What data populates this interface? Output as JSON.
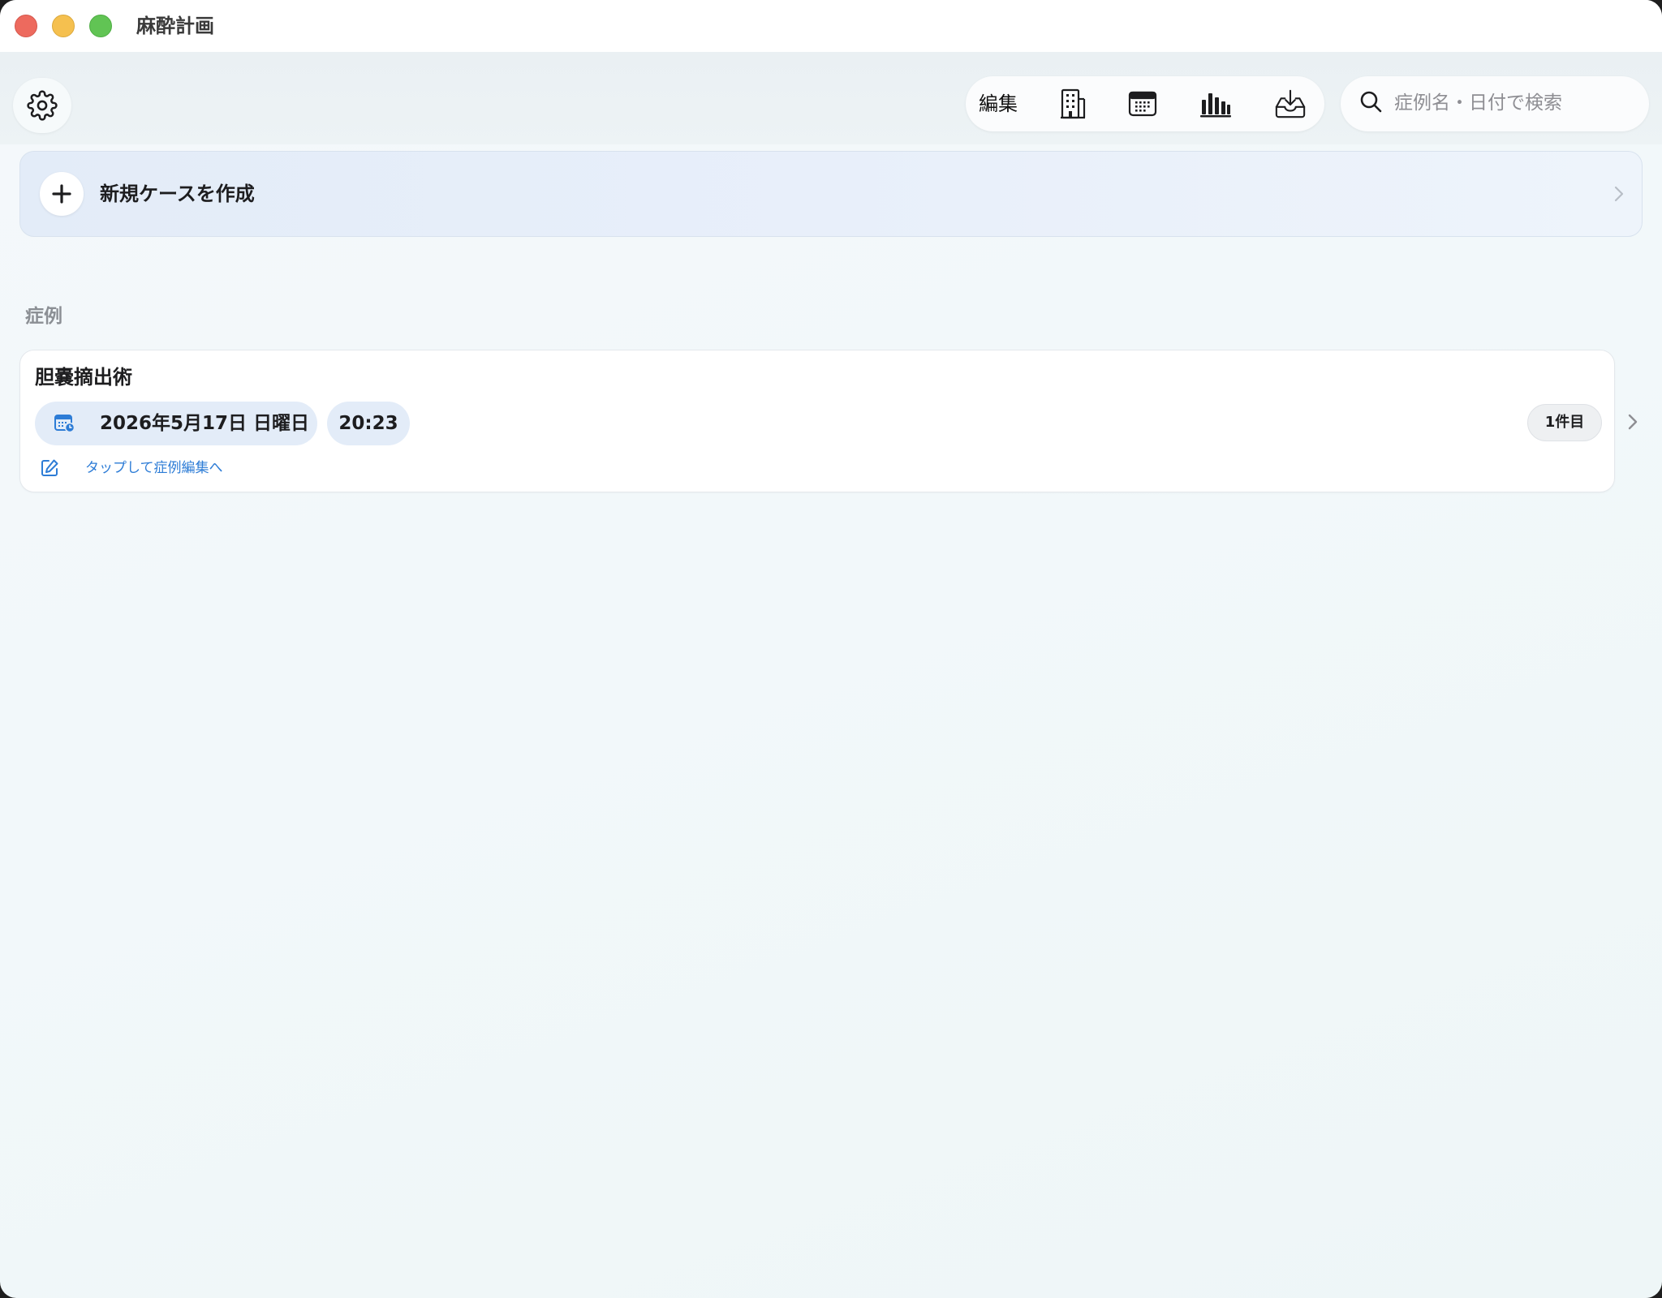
{
  "window": {
    "title": "麻酔計画"
  },
  "toolbar": {
    "settings_icon": "gear-icon",
    "edit_label": "編集",
    "icons": [
      "building-icon",
      "calendar-icon",
      "bar-chart-icon",
      "inbox-download-icon"
    ]
  },
  "search": {
    "placeholder": "症例名・日付で検索",
    "value": ""
  },
  "new_case": {
    "label": "新規ケースを作成"
  },
  "cases": {
    "section_title": "症例",
    "items": [
      {
        "name": "胆嚢摘出術",
        "date": "2026年5月17日 日曜日",
        "time": "20:23",
        "count": "1件目",
        "edit_hint": "タップして症例編集へ"
      }
    ]
  },
  "colors": {
    "accent": "#2d7cd6",
    "chip_bg": "#e3ecf8",
    "traffic_red": "#ed6a5e",
    "traffic_yellow": "#f5c04f",
    "traffic_green": "#61c454"
  }
}
